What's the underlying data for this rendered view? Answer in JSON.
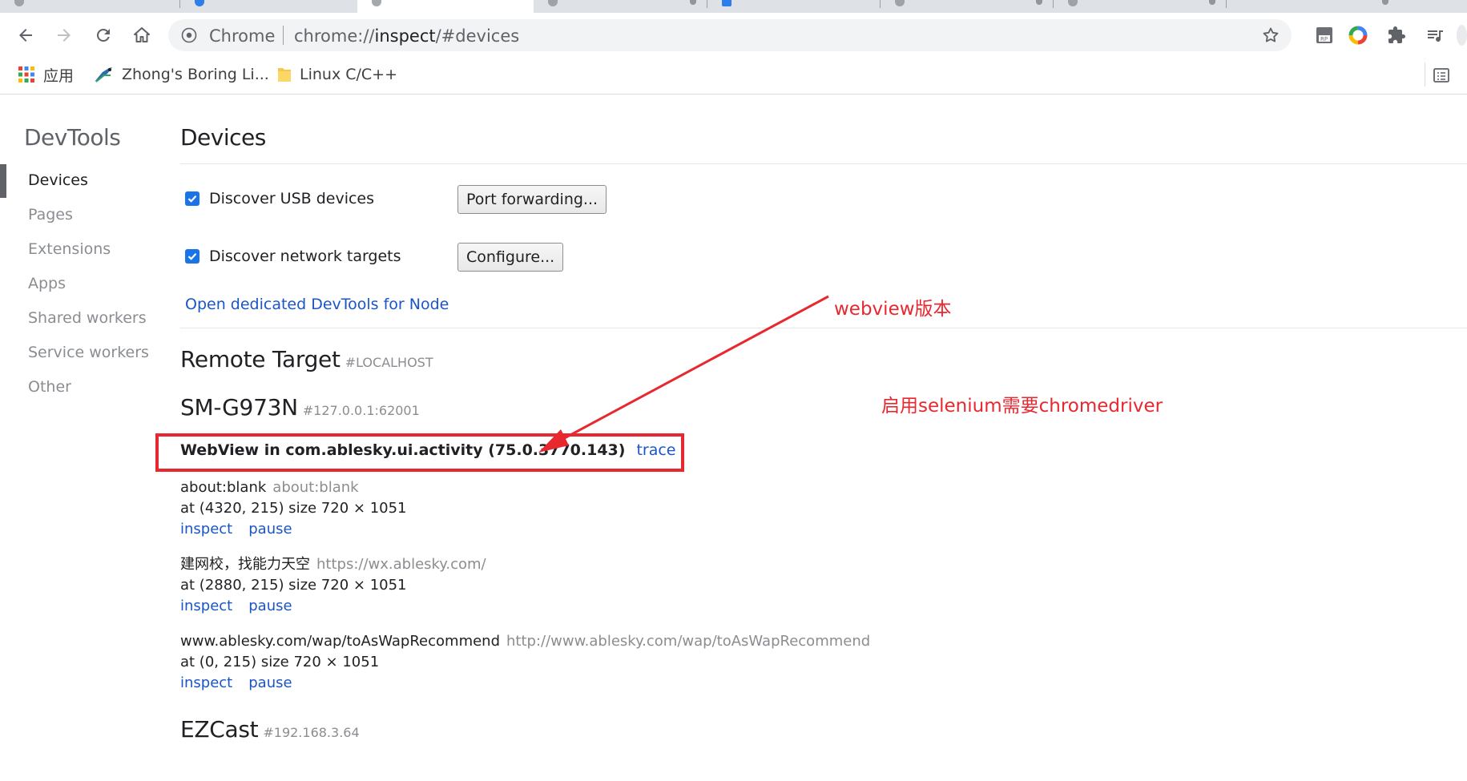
{
  "browser": {
    "omnibox": {
      "site_label": "Chrome",
      "url_scheme": "chrome://",
      "url_host": "inspect",
      "url_path": "/#devices"
    },
    "bookmarks": [
      {
        "label": "应用",
        "icon": "apps-grid-icon"
      },
      {
        "label": "Zhong's Boring Li...",
        "icon": "bookmark-favicon-icon"
      },
      {
        "label": "Linux C/C++",
        "icon": "folder-icon"
      }
    ]
  },
  "sidebar": {
    "title": "DevTools",
    "items": [
      {
        "label": "Devices",
        "selected": true
      },
      {
        "label": "Pages",
        "selected": false
      },
      {
        "label": "Extensions",
        "selected": false
      },
      {
        "label": "Apps",
        "selected": false
      },
      {
        "label": "Shared workers",
        "selected": false
      },
      {
        "label": "Service workers",
        "selected": false
      },
      {
        "label": "Other",
        "selected": false
      }
    ]
  },
  "main": {
    "title": "Devices",
    "usb": {
      "label": "Discover USB devices",
      "checked": true,
      "button": "Port forwarding..."
    },
    "network": {
      "label": "Discover network targets",
      "checked": true,
      "button": "Configure..."
    },
    "node_link": "Open dedicated DevTools for Node",
    "remote_target": {
      "title": "Remote Target",
      "hash": "#LOCALHOST"
    },
    "device": {
      "name": "SM-G973N",
      "hash": "#127.0.0.1:62001"
    },
    "browser": {
      "name": "WebView in com.ablesky.ui.activity (75.0.3770.143)",
      "trace": "trace"
    },
    "pages": [
      {
        "title": "about:blank",
        "url": "about:blank",
        "geometry": "at (4320, 215)  size 720 × 1051",
        "inspect": "inspect",
        "pause": "pause"
      },
      {
        "title": "建网校，找能力天空",
        "url": "https://wx.ablesky.com/",
        "geometry": "at (2880, 215)  size 720 × 1051",
        "inspect": "inspect",
        "pause": "pause"
      },
      {
        "title": "www.ablesky.com/wap/toAsWapRecommend",
        "url": "http://www.ablesky.com/wap/toAsWapRecommend",
        "geometry": "at (0, 215)  size 720 × 1051",
        "inspect": "inspect",
        "pause": "pause"
      }
    ],
    "device2": {
      "name": "EZCast",
      "hash": "#192.168.3.64"
    }
  },
  "annotations": {
    "webview_label": "webview版本",
    "selenium_label": "启用selenium需要chromedriver",
    "color": "#e8282f"
  },
  "colors": {
    "link": "#1a55c8",
    "checkbox": "#1a73e8",
    "sidebar_muted": "#8a8d91"
  }
}
